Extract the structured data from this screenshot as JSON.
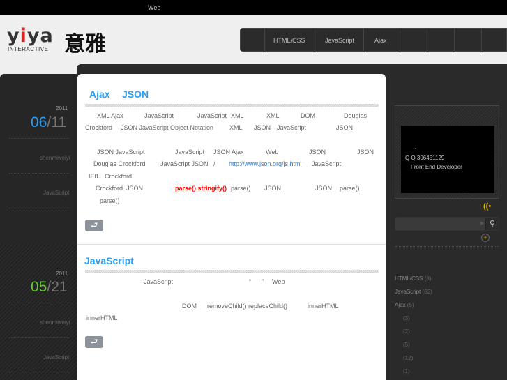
{
  "topbar": {
    "text": "Web"
  },
  "logo": {
    "brand": "yiya",
    "sub": "INTERACTIVE",
    "cn": "意雅"
  },
  "nav": {
    "items": [
      "HTML/CSS",
      "JavaScript",
      "Ajax"
    ]
  },
  "posts": [
    {
      "year": "2011",
      "month": "06",
      "day": "11",
      "month_color": "#2a9df4",
      "author": "shenmiweiyi",
      "category": "JavaScript",
      "title": [
        "Ajax",
        "JSON"
      ],
      "frags": [
        "XML Ajax",
        "JavaScript",
        "JavaScript",
        "XML",
        "XML",
        "DOM",
        "Douglas",
        "Crockford",
        "JSON JavaScript Object Notation",
        "XML",
        "JSON",
        "JavaScript",
        "JSON",
        "JSON JavaScript",
        "JavaScript",
        "JSON Ajax",
        "Web",
        "JSON",
        "JSON",
        "Douglas Crockford",
        "JavaScript JSON",
        "/",
        "http://www.json.org/js.html",
        "JavaScript",
        "IE8",
        "Crockford",
        "Crockford",
        "JSON",
        "parse() stringify()",
        "parse()",
        "JSON",
        "JSON",
        "parse()",
        "parse()"
      ],
      "more_icon": "return-arrow-icon"
    },
    {
      "year": "2011",
      "month": "05",
      "day": "21",
      "month_color": "#66cc33",
      "author": "shenmiweiyi",
      "category": "JavaScript",
      "title": [
        "JavaScript"
      ],
      "frags": [
        "JavaScript",
        "“",
        "”",
        "Web",
        "DOM",
        "removeChild() replaceChild()",
        "innerHTML",
        "innerHTML"
      ],
      "more_icon": "return-arrow-icon"
    }
  ],
  "sidebar": {
    "profile": {
      "dot": ".",
      "qq": "Q Q 306451129",
      "role": "Front End Developer"
    },
    "rss_icon": "rss-icon",
    "search_icon": "search-icon",
    "add_icon": "plus-circle-icon",
    "categories": [
      {
        "label": "HTML/CSS",
        "count": "(8)"
      },
      {
        "label": "JavaScript",
        "count": "(62)"
      },
      {
        "label": "Ajax",
        "count": "(5)"
      },
      {
        "label": "",
        "count": "(3)"
      },
      {
        "label": "",
        "count": "(2)"
      },
      {
        "label": "",
        "count": "(5)"
      },
      {
        "label": "",
        "count": "(12)"
      },
      {
        "label": "",
        "count": "(1)"
      }
    ]
  }
}
